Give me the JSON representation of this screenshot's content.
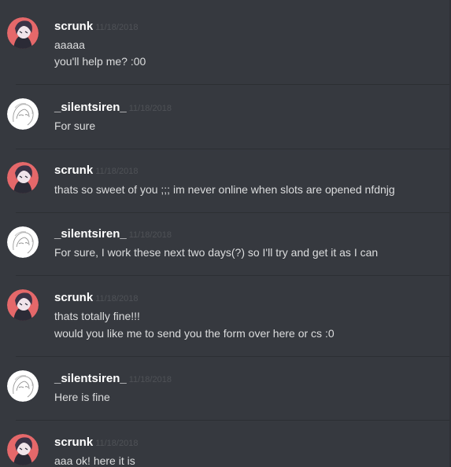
{
  "messages": [
    {
      "author": "scrunk",
      "avatar": "scrunk-avatar-icon",
      "timestamp": "11/18/2018",
      "lines": [
        "aaaaa",
        "you'll help me? :00"
      ]
    },
    {
      "author": "_silentsiren_",
      "avatar": "silentsiren-avatar-icon",
      "timestamp": "11/18/2018",
      "lines": [
        "For sure"
      ]
    },
    {
      "author": "scrunk",
      "avatar": "scrunk-avatar-icon",
      "timestamp": "11/18/2018",
      "lines": [
        "thats so sweet of you ;;; im never online when slots are opened nfdnjg"
      ]
    },
    {
      "author": "_silentsiren_",
      "avatar": "silentsiren-avatar-icon",
      "timestamp": "11/18/2018",
      "lines": [
        "For sure, I work these next two days(?) so I'll try and get it as I can"
      ]
    },
    {
      "author": "scrunk",
      "avatar": "scrunk-avatar-icon",
      "timestamp": "11/18/2018",
      "lines": [
        "thats totally fine!!!",
        "would you like me to send you the form over here or cs :0"
      ]
    },
    {
      "author": "_silentsiren_",
      "avatar": "silentsiren-avatar-icon",
      "timestamp": "11/18/2018",
      "lines": [
        "Here is fine"
      ]
    },
    {
      "author": "scrunk",
      "avatar": "scrunk-avatar-icon",
      "timestamp": "11/18/2018",
      "lines": [
        "aaa ok! here it is"
      ]
    }
  ],
  "colors": {
    "background": "#36393f",
    "username": "#ffffff",
    "timestamp": "#4f5257",
    "message_text": "#dcddde",
    "divider": "#2c2f33"
  }
}
